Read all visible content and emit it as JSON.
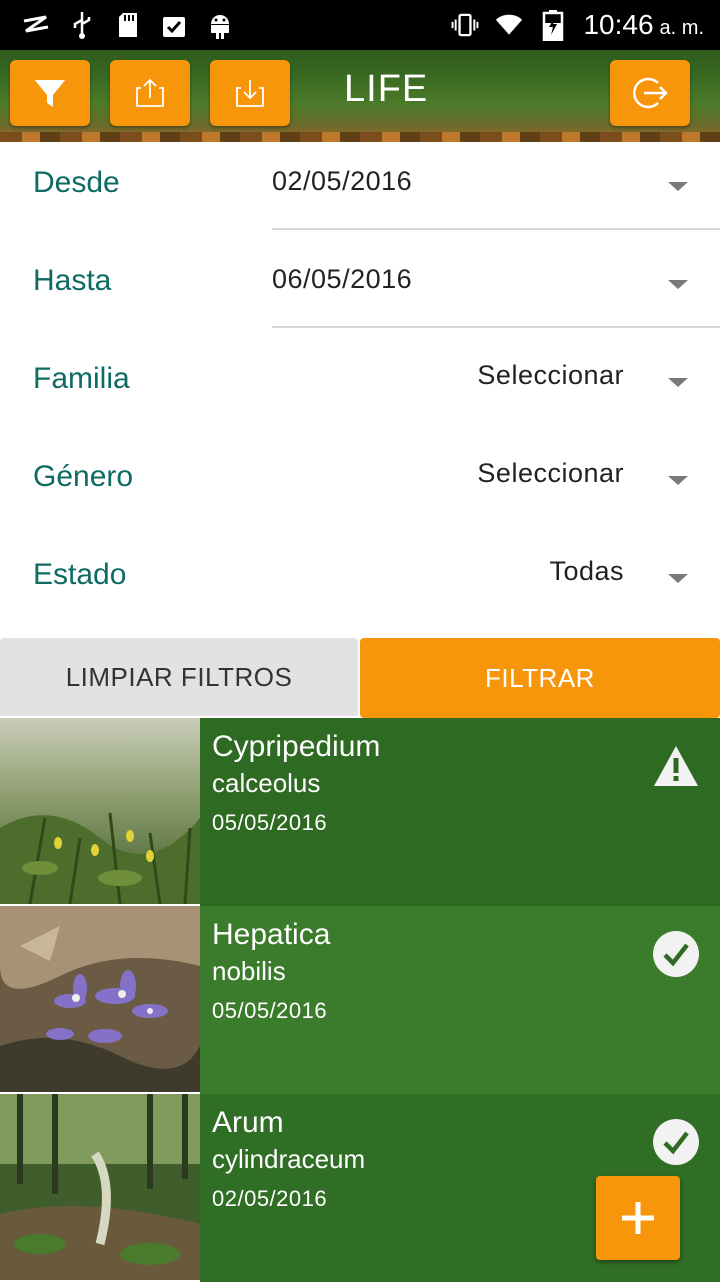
{
  "status_bar": {
    "time": "10:46",
    "ampm": "a. m."
  },
  "toolbar": {
    "title": "LIFE"
  },
  "filters": [
    {
      "label": "Desde",
      "value": "02/05/2016"
    },
    {
      "label": "Hasta",
      "value": "06/05/2016"
    },
    {
      "label": "Familia",
      "value": "Seleccionar"
    },
    {
      "label": "Género",
      "value": "Seleccionar"
    },
    {
      "label": "Estado",
      "value": "Todas"
    }
  ],
  "buttons": {
    "clear": "LIMPIAR FILTROS",
    "filter": "FILTRAR"
  },
  "records": [
    {
      "genus": "Cypripedium",
      "species": "calceolus",
      "date": "05/05/2016",
      "status_icon": "warning-icon"
    },
    {
      "genus": "Hepatica",
      "species": "nobilis",
      "date": "05/05/2016",
      "status_icon": "check-icon"
    },
    {
      "genus": "Arum",
      "species": "cylindraceum",
      "date": "02/05/2016",
      "status_icon": "check-icon"
    }
  ],
  "colors": {
    "accent": "#f7960b",
    "label": "#0e6b64",
    "list_dark": "#2f6b23",
    "list_mid": "#3d7d2c"
  }
}
